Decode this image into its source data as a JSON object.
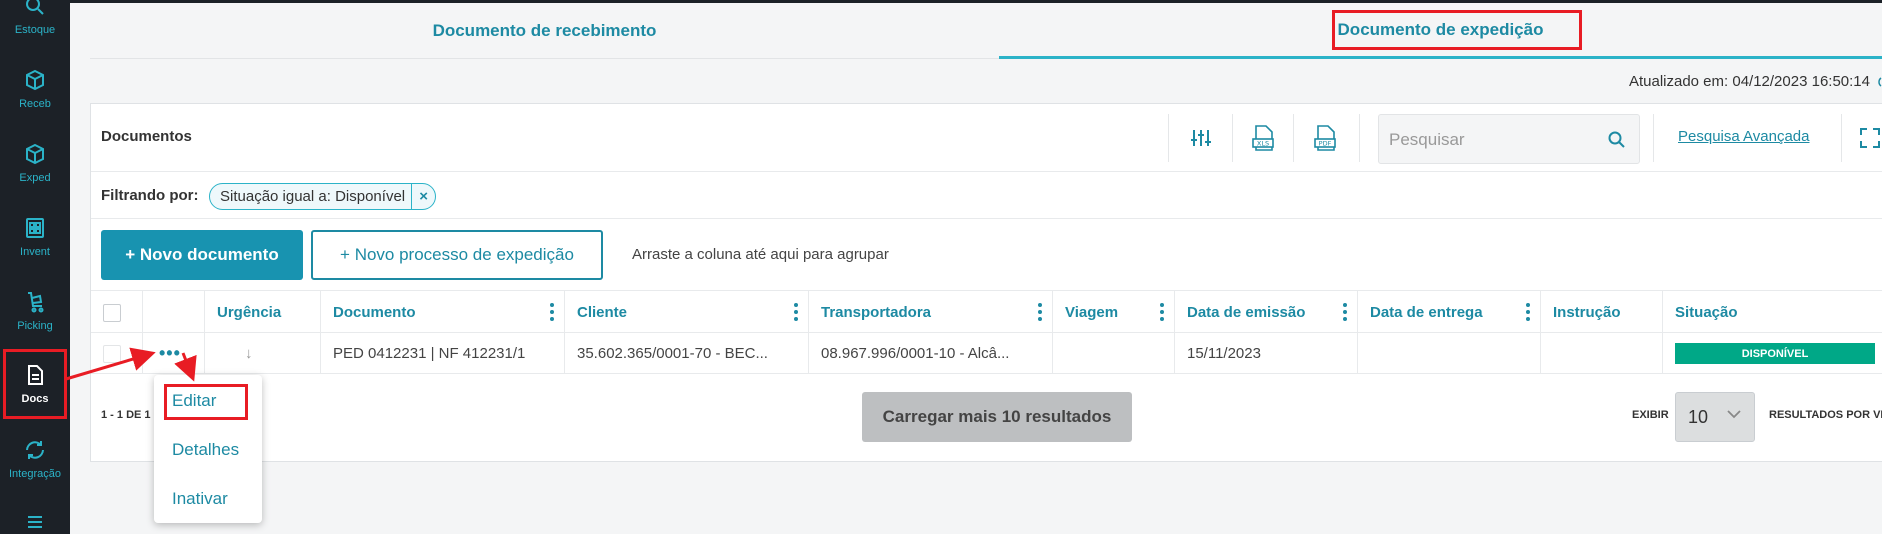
{
  "sidebar": {
    "items": [
      {
        "label": "Estoque",
        "icon": "search-icon"
      },
      {
        "label": "Receb",
        "icon": "box-icon"
      },
      {
        "label": "Exped",
        "icon": "box-icon"
      },
      {
        "label": "Invent",
        "icon": "building-icon"
      },
      {
        "label": "Picking",
        "icon": "cart-icon"
      },
      {
        "label": "Docs",
        "icon": "document-icon"
      },
      {
        "label": "Integração",
        "icon": "sync-icon"
      },
      {
        "label": "",
        "icon": "list-icon"
      }
    ]
  },
  "tabs": {
    "receiving": "Documento de recebimento",
    "shipping": "Documento de expedição"
  },
  "updated": "Atualizado em: 04/12/2023 16:50:14",
  "toolbar": {
    "title": "Documentos",
    "search_placeholder": "Pesquisar",
    "advanced": "Pesquisa Avançada"
  },
  "filter": {
    "label": "Filtrando por:",
    "chip": "Situação igual a: Disponível",
    "chip_close": "×"
  },
  "actions": {
    "new_document": "+ Novo documento",
    "new_process": "+ Novo processo de expedição",
    "drag_hint": "Arraste a coluna até aqui para agrupar"
  },
  "table": {
    "headers": [
      "Urgência",
      "Documento",
      "Cliente",
      "Transportadora",
      "Viagem",
      "Data de emissão",
      "Data de entrega",
      "Instrução",
      "Situação"
    ],
    "row": {
      "menu": "•••",
      "urgency": "↓",
      "document": "PED 0412231 | NF 412231/1",
      "client": "35.602.365/0001-70 - BEC...",
      "carrier": "08.967.996/0001-10 - Alcâ...",
      "trip": "",
      "issue_date": "15/11/2023",
      "delivery_date": "",
      "instruction": "",
      "status": "DISPONÍVEL"
    }
  },
  "pager": {
    "count": "1 - 1 DE 1",
    "load_more": "Carregar mais 10 resultados",
    "show": "EXIBIR",
    "per_page": "10",
    "results_per_page": "RESULTADOS POR VE"
  },
  "context_menu": {
    "items": [
      "Editar",
      "Detalhes",
      "Inativar"
    ]
  },
  "colors": {
    "accent": "#1d8aa3",
    "sidebar_bg": "#1c2127",
    "status_green": "#00a887",
    "highlight_red": "#e81c24"
  }
}
